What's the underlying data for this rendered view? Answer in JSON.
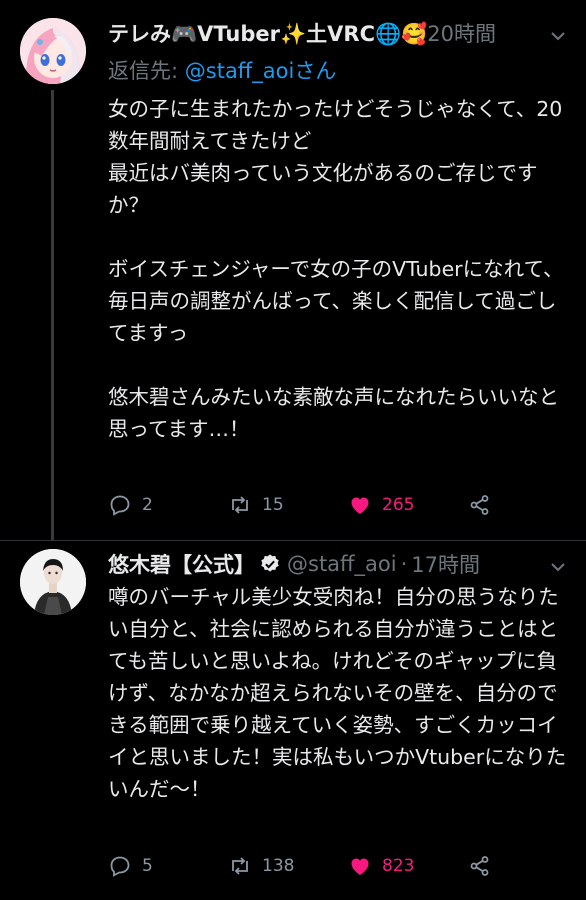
{
  "tweets": [
    {
      "display_name": "テレみ🎮VTuber✨土VRC🌐🥰",
      "time": "20時間",
      "replying_prefix": "返信先: ",
      "replying_handle": "@staff_aoiさん",
      "text": "女の子に生まれたかったけどそうじゃなくて、20数年間耐えてきたけど\n最近はバ美肉っていう文化があるのご存じですか？\n\nボイスチェンジャーで女の子のVTuberになれて、\n毎日声の調整がんばって、楽しく配信して過ごしてますっ\n\n悠木碧さんみたいな素敵な声になれたらいいなと思ってます…！",
      "replies": "2",
      "retweets": "15",
      "likes": "265",
      "liked": true
    },
    {
      "display_name": "悠木碧【公式】",
      "handle": "@staff_aoi",
      "separator": "·",
      "time": "17時間",
      "text": "噂のバーチャル美少女受肉ね！自分の思うなりたい自分と、社会に認められる自分が違うことはとても苦しいと思いよね。けれどそのギャップに負けず、なかなか超えられないその壁を、自分のできる範囲で乗り越えていく姿勢、すごくカッコイイと思いました！実は私もいつかVtuberになりたいんだ〜！",
      "replies": "5",
      "retweets": "138",
      "likes": "823",
      "liked": true
    }
  ],
  "colors": {
    "background": "#000000",
    "text": "#e7e9ea",
    "muted": "#6e767d",
    "link": "#1d9bf0",
    "like": "#f91880"
  }
}
